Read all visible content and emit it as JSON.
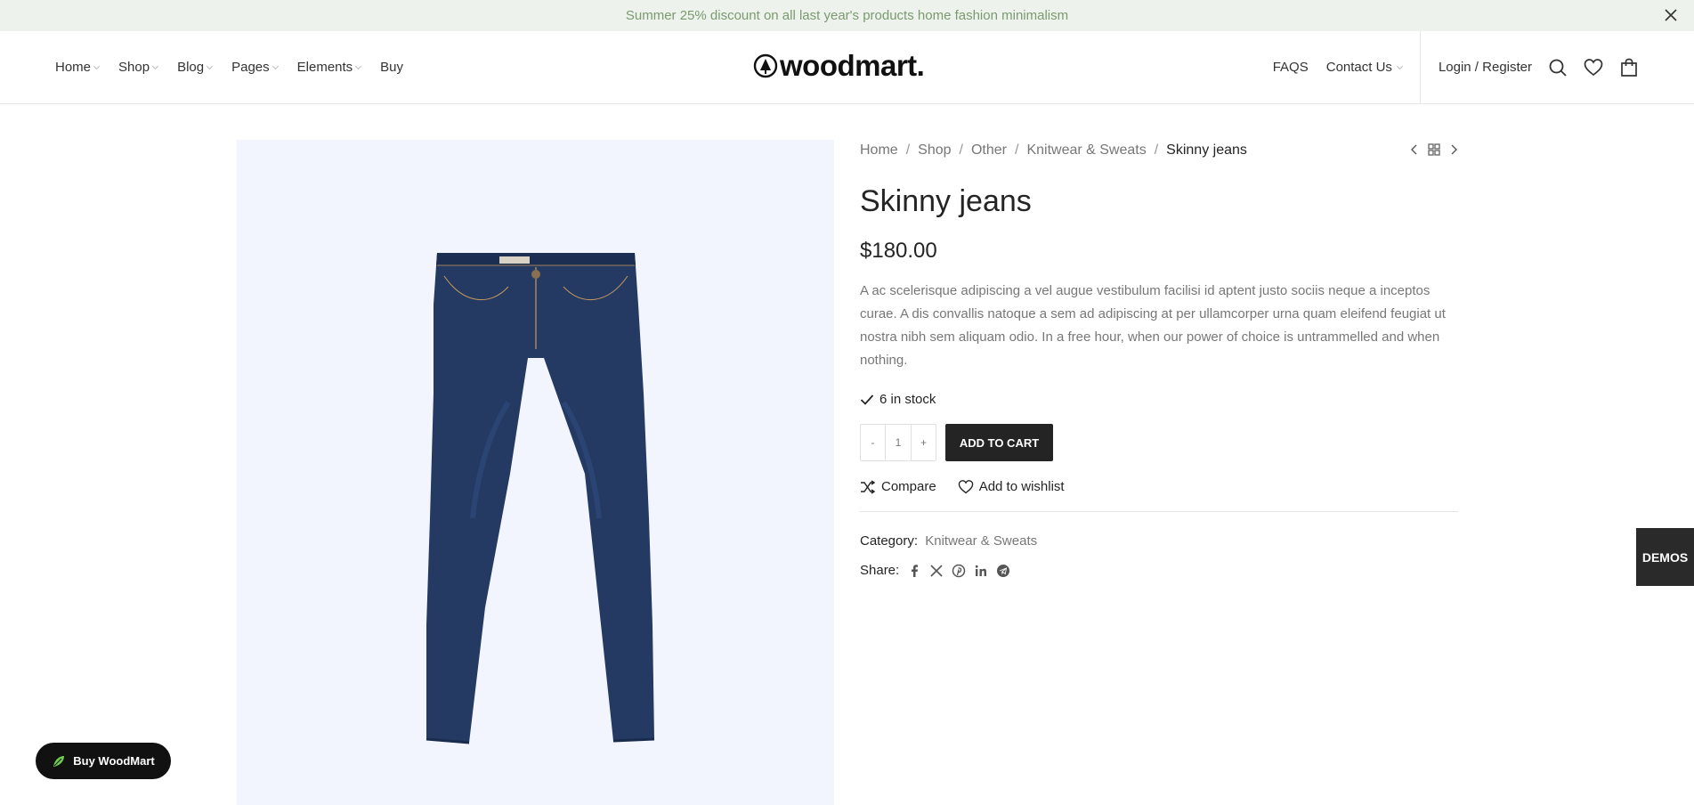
{
  "promo": {
    "text": "Summer 25% discount on all last year's products home fashion minimalism"
  },
  "nav_left": [
    {
      "label": "Home",
      "dropdown": true
    },
    {
      "label": "Shop",
      "dropdown": true
    },
    {
      "label": "Blog",
      "dropdown": true
    },
    {
      "label": "Pages",
      "dropdown": true
    },
    {
      "label": "Elements",
      "dropdown": true
    },
    {
      "label": "Buy",
      "dropdown": false
    }
  ],
  "logo": {
    "text": "woodmart."
  },
  "nav_right": {
    "faqs": "FAQS",
    "contact": "Contact Us",
    "login": "Login / Register"
  },
  "breadcrumbs": [
    "Home",
    "Shop",
    "Other",
    "Knitwear & Sweats",
    "Skinny jeans"
  ],
  "product": {
    "title": "Skinny jeans",
    "price": "$180.00",
    "description": "A ac scelerisque adipiscing a vel augue vestibulum facilisi id aptent justo sociis neque a inceptos curae. A dis convallis natoque a sem ad adipiscing at per ullamcorper urna quam eleifend feugiat ut nostra nibh sem aliquam odio. In a free hour, when our power of choice is untrammelled and when nothing.",
    "stock": "6 in stock",
    "qty_minus": "-",
    "qty_value": "1",
    "qty_plus": "+",
    "add_to_cart": "ADD TO CART",
    "compare": "Compare",
    "wishlist": "Add to wishlist",
    "category_label": "Category:",
    "category_value": "Knitwear & Sweats",
    "share_label": "Share:"
  },
  "demos": "DEMOS",
  "buy_pill": "Buy WoodMart",
  "colors": {
    "promo_bg": "#eef2ec",
    "promo_text": "#7a9a70",
    "gallery_bg": "#f2f4fe",
    "dark": "#242424",
    "denim": "#243a63"
  },
  "icons": [
    "close-icon",
    "search-icon",
    "heart-icon",
    "bag-icon",
    "check-icon",
    "shuffle-icon",
    "facebook-icon",
    "x-icon",
    "pinterest-icon",
    "linkedin-icon",
    "telegram-icon",
    "leaf-icon"
  ]
}
